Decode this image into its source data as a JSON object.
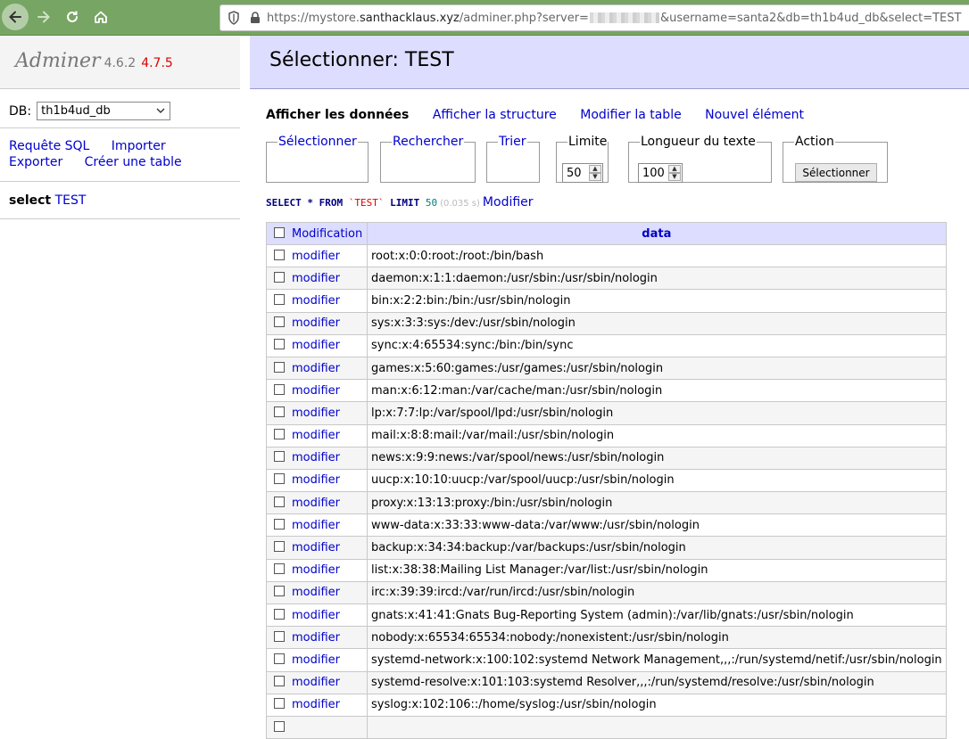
{
  "browser": {
    "url_prefix": "https://mystore.",
    "url_host": "santhacklaus.xyz",
    "url_path": "/adminer.php?server=",
    "url_suffix": "&username=santa2&db=th1b4ud_db&select=TEST"
  },
  "brand": {
    "name": "Adminer",
    "version": "4.6.2",
    "new_version": "4.7.5"
  },
  "db": {
    "label": "DB:",
    "selected": "th1b4ud_db"
  },
  "sidebar_links": {
    "sql": "Requête SQL",
    "import": "Importer",
    "export": "Exporter",
    "create": "Créer une table"
  },
  "tables": {
    "select_label": "select",
    "table_name": "TEST"
  },
  "page": {
    "title": "Sélectionner: TEST"
  },
  "tabs": [
    {
      "label": "Afficher les données"
    },
    {
      "label": "Afficher la structure"
    },
    {
      "label": "Modifier la table"
    },
    {
      "label": "Nouvel élément"
    }
  ],
  "filters": {
    "select": "Sélectionner",
    "search": "Rechercher",
    "sort": "Trier",
    "limit_label": "Limite",
    "limit_value": "50",
    "text_length_label": "Longueur du texte",
    "text_length_value": "100",
    "action_label": "Action",
    "action_button": "Sélectionner"
  },
  "query": {
    "kw1": "SELECT * FROM",
    "table": "`TEST`",
    "kw2": "LIMIT",
    "limit": "50",
    "time": "(0.035 s)",
    "edit": "Modifier"
  },
  "grid": {
    "col_modification": "Modification",
    "col_data": "data",
    "edit_label": "modifier",
    "rows": [
      "root:x:0:0:root:/root:/bin/bash",
      "daemon:x:1:1:daemon:/usr/sbin:/usr/sbin/nologin",
      "bin:x:2:2:bin:/bin:/usr/sbin/nologin",
      "sys:x:3:3:sys:/dev:/usr/sbin/nologin",
      "sync:x:4:65534:sync:/bin:/bin/sync",
      "games:x:5:60:games:/usr/games:/usr/sbin/nologin",
      "man:x:6:12:man:/var/cache/man:/usr/sbin/nologin",
      "lp:x:7:7:lp:/var/spool/lpd:/usr/sbin/nologin",
      "mail:x:8:8:mail:/var/mail:/usr/sbin/nologin",
      "news:x:9:9:news:/var/spool/news:/usr/sbin/nologin",
      "uucp:x:10:10:uucp:/var/spool/uucp:/usr/sbin/nologin",
      "proxy:x:13:13:proxy:/bin:/usr/sbin/nologin",
      "www-data:x:33:33:www-data:/var/www:/usr/sbin/nologin",
      "backup:x:34:34:backup:/var/backups:/usr/sbin/nologin",
      "list:x:38:38:Mailing List Manager:/var/list:/usr/sbin/nologin",
      "irc:x:39:39:ircd:/var/run/ircd:/usr/sbin/nologin",
      "gnats:x:41:41:Gnats Bug-Reporting System (admin):/var/lib/gnats:/usr/sbin/nologin",
      "nobody:x:65534:65534:nobody:/nonexistent:/usr/sbin/nologin",
      "systemd-network:x:100:102:systemd Network Management,,,:/run/systemd/netif:/usr/sbin/nologin",
      "systemd-resolve:x:101:103:systemd Resolver,,,:/run/systemd/resolve:/usr/sbin/nologin",
      "syslog:x:102:106::/home/syslog:/usr/sbin/nologin",
      ""
    ]
  },
  "colors": {
    "chrome": "#77a563",
    "header_bg": "#ddddff",
    "link": "#0000cc",
    "new_version": "#dd0000"
  }
}
